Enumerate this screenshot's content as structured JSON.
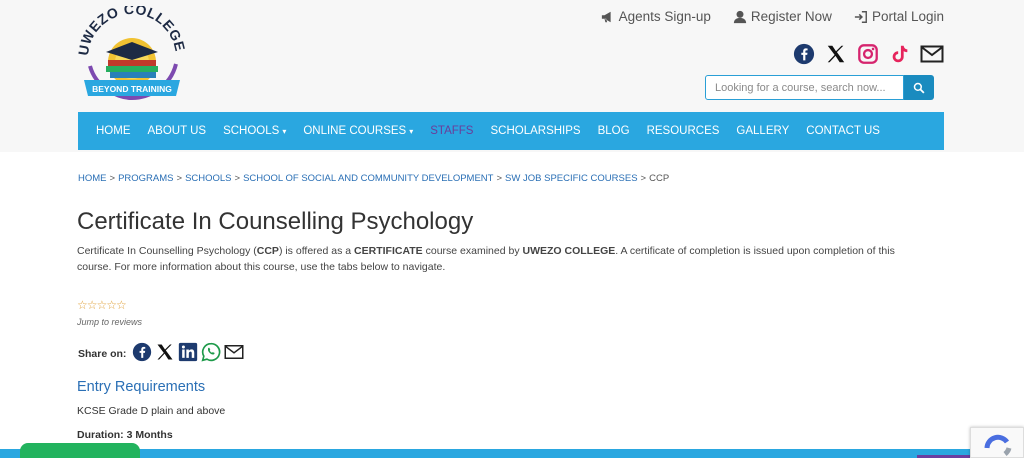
{
  "logo": {
    "top_text": "UWEZO COLLEGE",
    "ribbon_text": "BEYOND TRAINING"
  },
  "toplinks": [
    {
      "label": "Agents Sign-up",
      "icon": "megaphone-icon"
    },
    {
      "label": "Register Now",
      "icon": "user-icon"
    },
    {
      "label": "Portal Login",
      "icon": "sign-in-icon"
    }
  ],
  "socials": [
    "facebook-icon",
    "x-icon",
    "instagram-icon",
    "tiktok-icon",
    "email-icon"
  ],
  "search": {
    "placeholder": "Looking for a course, search now..."
  },
  "nav": [
    {
      "label": "HOME"
    },
    {
      "label": "ABOUT US"
    },
    {
      "label": "SCHOOLS"
    },
    {
      "label": "ONLINE COURSES"
    },
    {
      "label": "STAFFS"
    },
    {
      "label": "SCHOLARSHIPS"
    },
    {
      "label": "BLOG"
    },
    {
      "label": "RESOURCES"
    },
    {
      "label": "GALLERY"
    },
    {
      "label": "CONTACT US"
    }
  ],
  "breadcrumb": [
    "HOME",
    "PROGRAMS",
    "SCHOOLS",
    "SCHOOL OF SOCIAL AND COMMUNITY DEVELOPMENT",
    "SW JOB SPECIFIC COURSES",
    "CCP"
  ],
  "breadcrumb_sep": ">",
  "caret": "▾",
  "page": {
    "title": "Certificate In Counselling Psychology",
    "desc_1": "Certificate In Counselling Psychology (",
    "desc_code": "CCP",
    "desc_2": ") is offered as a ",
    "desc_level": "CERTIFICATE",
    "desc_3": " course examined by ",
    "desc_examiner": "UWEZO COLLEGE",
    "desc_4": ". A certificate of completion is issued upon completion of this course. For more information about this course, use the tabs below to navigate.",
    "stars": "☆☆☆☆☆",
    "rating": 0,
    "jump": "Jump to reviews",
    "share_label": "Share on:",
    "entry_heading": "Entry Requirements",
    "entry_text": "KCSE Grade D plain and above",
    "duration": "Duration: 3 Months"
  },
  "colors": {
    "nav": "#2aa7e0",
    "staffs": "#6a3d9a",
    "link": "#2a6fb5",
    "search_btn": "#1a8bbf"
  }
}
